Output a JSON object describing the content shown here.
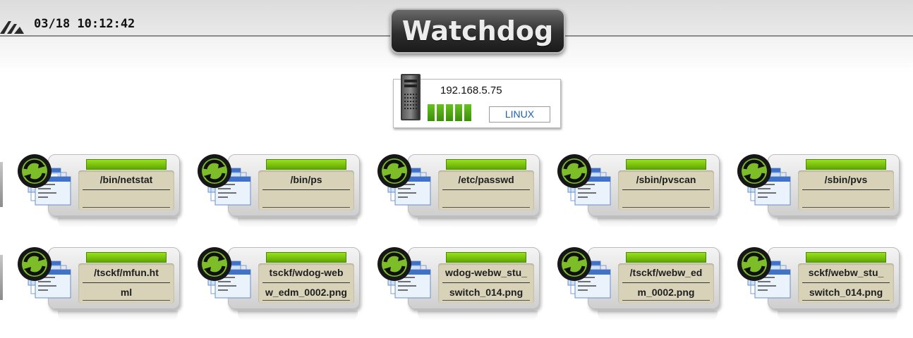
{
  "header": {
    "datetime": "03/18 10:12:42",
    "brand": "Watchdog"
  },
  "host": {
    "ip": "192.168.5.75",
    "os": "LINUX",
    "signal_bars": 5,
    "bar_color": "#4fa814"
  },
  "colors": {
    "status_ok": "#7cc80f",
    "plate": "#d8d3b8",
    "os_text": "#1a5fb8"
  },
  "monitors": [
    {
      "line1": "/bin/netstat",
      "line2": "",
      "icon": "refresh-window-icon"
    },
    {
      "line1": "/bin/ps",
      "line2": "",
      "icon": "refresh-window-icon"
    },
    {
      "line1": "/etc/passwd",
      "line2": "",
      "icon": "refresh-window-icon"
    },
    {
      "line1": "/sbin/pvscan",
      "line2": "",
      "icon": "refresh-window-icon"
    },
    {
      "line1": "/sbin/pvs",
      "line2": "",
      "icon": "refresh-window-icon"
    },
    {
      "line1": "/tsckf/mfun.ht",
      "line2": "ml",
      "icon": "refresh-window-icon"
    },
    {
      "line1": "tsckf/wdog-web",
      "line2": "w_edm_0002.png",
      "icon": "refresh-window-icon"
    },
    {
      "line1": "wdog-webw_stu_",
      "line2": "switch_014.png",
      "icon": "refresh-window-icon"
    },
    {
      "line1": "/tsckf/webw_ed",
      "line2": "m_0002.png",
      "icon": "refresh-window-icon"
    },
    {
      "line1": "sckf/webw_stu_",
      "line2": "switch_014.png",
      "icon": "refresh-window-icon"
    }
  ]
}
